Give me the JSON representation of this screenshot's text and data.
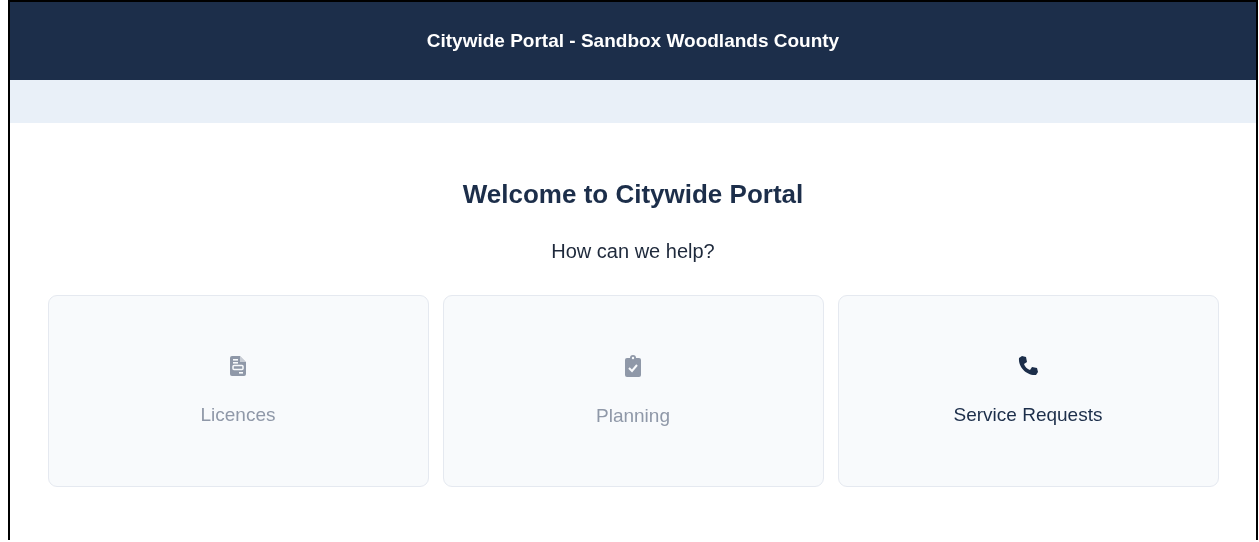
{
  "header": {
    "title": "Citywide Portal - Sandbox Woodlands County"
  },
  "welcome": {
    "heading": "Welcome to Citywide Portal",
    "subheading": "How can we help?"
  },
  "cards": [
    {
      "label": "Licences",
      "kind": "document",
      "disabled": true
    },
    {
      "label": "Planning",
      "kind": "clipboard",
      "disabled": true
    },
    {
      "label": "Service Requests",
      "kind": "phone",
      "disabled": false
    }
  ]
}
